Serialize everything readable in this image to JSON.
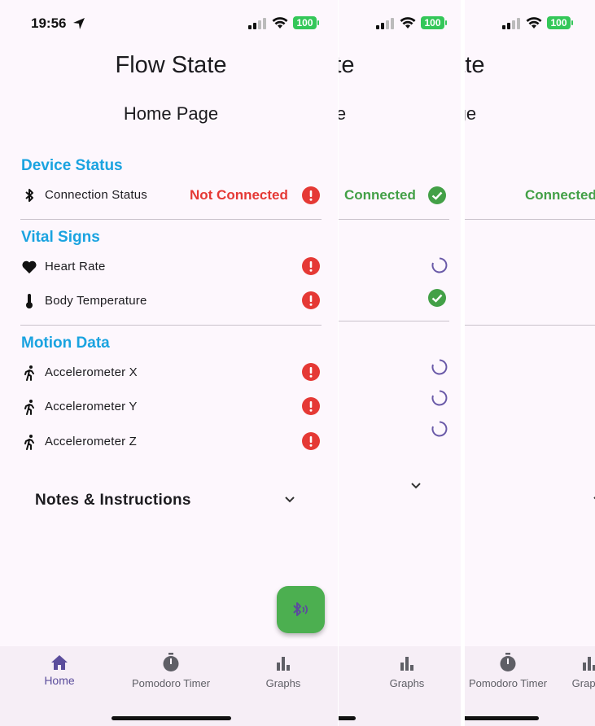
{
  "status_bar": {
    "time": "19:56",
    "battery": "100"
  },
  "app": {
    "title": "Flow State",
    "page_title": "Home Page"
  },
  "sections": {
    "device_status": "Device Status",
    "vital_signs": "Vital Signs",
    "motion_data": "Motion Data"
  },
  "rows": {
    "connection_status": "Connection Status",
    "heart_rate": "Heart Rate",
    "body_temperature": "Body Temperature",
    "accel_x": "Accelerometer X",
    "accel_y": "Accelerometer Y",
    "accel_z": "Accelerometer Z"
  },
  "connection": {
    "disconnected": "Not Connected",
    "connected": "Connected"
  },
  "notes": {
    "label": "Notes & Instructions"
  },
  "nav": {
    "home": "Home",
    "pomodoro": "Pomodoro Timer",
    "graphs": "Graphs"
  },
  "colors": {
    "accent": "#1aa3e0",
    "error": "#e53935",
    "success": "#43a047",
    "fab": "#4caf50",
    "nav_active": "#5b4d9c",
    "spinner": "#6a5aa8"
  },
  "icons": {
    "bluetooth": "bluetooth-icon",
    "heart": "heart-icon",
    "thermometer": "thermometer-icon",
    "running": "running-icon",
    "error": "error-icon",
    "check": "check-circle-icon",
    "spinner": "loading-spinner-icon",
    "home": "home-icon",
    "timer": "timer-icon",
    "graphs": "bar-chart-icon",
    "fab": "bluetooth-searching-icon"
  }
}
